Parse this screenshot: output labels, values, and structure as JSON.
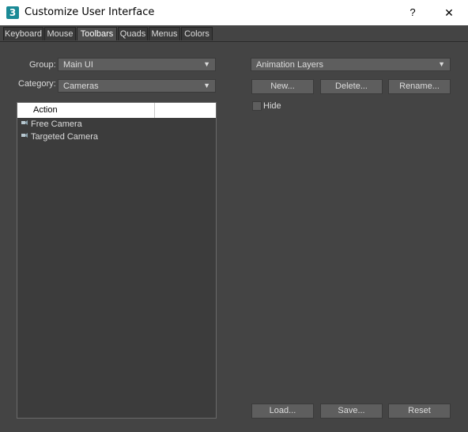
{
  "window": {
    "title": "Customize User Interface",
    "help": "?",
    "close": "✕",
    "app_icon": "3"
  },
  "tabs": [
    "Keyboard",
    "Mouse",
    "Toolbars",
    "Quads",
    "Menus",
    "Colors"
  ],
  "active_tab": "Toolbars",
  "group": {
    "label": "Group:",
    "value": "Main UI"
  },
  "category": {
    "label": "Category:",
    "value": "Cameras"
  },
  "list": {
    "header": "Action",
    "items": [
      {
        "label": "Free Camera",
        "icon": "camera-icon"
      },
      {
        "label": "Targeted Camera",
        "icon": "camera-icon"
      }
    ]
  },
  "toolbar_select": {
    "value": "Animation Layers"
  },
  "buttons": {
    "new": "New...",
    "delete": "Delete...",
    "rename": "Rename...",
    "load": "Load...",
    "save": "Save...",
    "reset": "Reset"
  },
  "hide": {
    "label": "Hide",
    "checked": false
  },
  "colors": {
    "background": "#444444",
    "control": "#5e5e5e",
    "list_bg": "#3c3c3c",
    "text": "#dcdcdc",
    "icon_teal": "#1a8a96"
  }
}
